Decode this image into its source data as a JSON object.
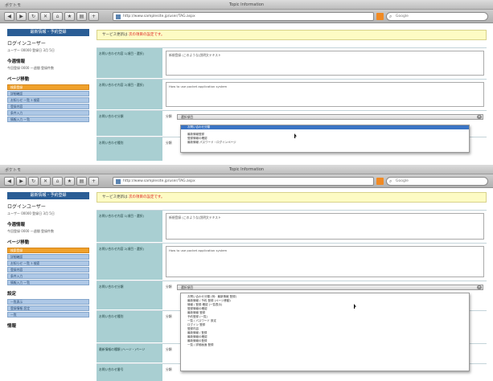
{
  "screens": [
    {
      "titlebar": {
        "app": "ポケトモ",
        "window_title": "Topic Information"
      },
      "toolbar": {
        "url": "http://www.samplesite.jp/user/TAG.aspx",
        "search_placeholder": "Google"
      },
      "sidebar": {
        "header": "最新情報・予約登録",
        "login_title": "ログインユーザー",
        "login_info": "ユーザー 00000 登録日 3月 5日",
        "section_title": "今週情報",
        "section_info": "今回登録 0000 一週間 登録件数",
        "menu_title": "ページ移動",
        "menu_items": [
          "検索登録",
          "詳細確認",
          "お知らせ 一覧 3 検索",
          "登録内容",
          "条件入力",
          "情報入力 一覧"
        ]
      },
      "content": {
        "notice": "サービス更新は",
        "notice_red": "次の項目の設定です。",
        "rows": [
          {
            "label": "お問い合わせ内容 1(項目・選択)",
            "value": "新規登録 (このような)説明文テキスト"
          },
          {
            "label": "お問い合わせ内容 2(項目・選択)",
            "value": "How to use pocket application system"
          },
          {
            "label": "お問い合わせ分類",
            "small": "分類",
            "select_value": "選択項目"
          },
          {
            "label": "お問い合わせ種別",
            "small": "分類"
          }
        ],
        "dropdown_items": [
          "お問い合わせ分類",
          "最新情報登録",
          "登録情報の確認",
          "最新情報 パスワード・ログインページ"
        ],
        "dropdown_selected": 0
      }
    },
    {
      "titlebar": {
        "app": "ポケトモ",
        "window_title": "Topic Information"
      },
      "toolbar": {
        "url": "http://www.samplesite.jp/user/TAG.aspx",
        "search_placeholder": "Google"
      },
      "sidebar": {
        "header": "最新情報・予約登録",
        "login_title": "ログインユーザー",
        "login_info": "ユーザー 00000 登録日 3月 5日",
        "section_title": "今週情報",
        "section_info": "今回登録 0000 一週間 登録件数",
        "menu_title": "ページ移動",
        "menu_items": [
          "検索登録",
          "詳細確認",
          "お知らせ 一覧 3 検索",
          "登録内容",
          "条件入力",
          "情報入力 一覧"
        ],
        "extra_title": "設定",
        "extra_items": [
          "一覧表示",
          "登録情報 設定",
          "一覧"
        ],
        "extra_title2": "情報"
      },
      "content": {
        "notice": "サービス更新は",
        "notice_red": "次の項目の設定です。",
        "rows": [
          {
            "label": "お問い合わせ内容 1(項目・選択)",
            "value": "新規登録 (このような)説明文テキスト"
          },
          {
            "label": "お問い合わせ内容 2(項目・選択)",
            "value": "How to use pocket application system"
          },
          {
            "label": "お問い合わせ分類",
            "small": "分類",
            "select_value": "選択項目"
          },
          {
            "label": "お問い合わせ種別",
            "small": "分類"
          },
          {
            "label": "最新情報の種類 (ヘージ・)ページ",
            "small": "分類"
          },
          {
            "label": "お問い合わせ番号",
            "small": "分類"
          }
        ],
        "dropdown_items": [
          "お問い合わせ分類 (例：最新情報 登録)",
          "最新情報 / 予約 登録 (ページ移動)",
          "情報 / 登録 確認 (一覧表示)",
          "登録情報の確認",
          "最新情報 登録",
          "予約登録 (一覧)",
          "一覧 / パスワード 設定",
          "ログイン 登録",
          "登録内容",
          "最新情報 / 登録",
          "最新情報の確認",
          "最新情報の登録",
          "一覧 / 詳細画面 登録"
        ],
        "dropdown_selected": -1
      }
    }
  ]
}
